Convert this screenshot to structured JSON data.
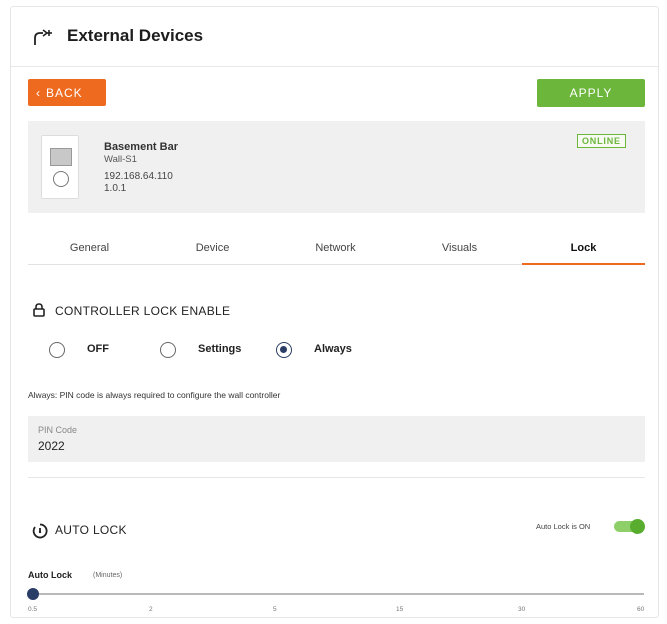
{
  "header": {
    "title": "External Devices",
    "icon": "external-device-icon"
  },
  "actions": {
    "back_label": "BACK",
    "back_icon": "chevron-left-icon",
    "apply_label": "APPLY"
  },
  "device": {
    "name": "Basement Bar",
    "model": "Wall-S1",
    "ip": "192.168.64.110",
    "version": "1.0.1",
    "status": "ONLINE"
  },
  "tabs": [
    {
      "label": "General"
    },
    {
      "label": "Device"
    },
    {
      "label": "Network"
    },
    {
      "label": "Visuals"
    },
    {
      "label": "Lock",
      "active": true
    }
  ],
  "lock": {
    "title": "CONTROLLER LOCK ENABLE",
    "options": [
      {
        "label": "OFF",
        "selected": false
      },
      {
        "label": "Settings",
        "selected": false
      },
      {
        "label": "Always",
        "selected": true
      }
    ],
    "description": "Always: PIN code is always required to configure the wall controller",
    "pin_label": "PIN Code",
    "pin_value": "2022"
  },
  "auto_lock": {
    "title": "AUTO LOCK",
    "toggle_label": "Auto Lock is ON",
    "toggle_on": true,
    "slider_label": "Auto Lock",
    "slider_unit": "(Minutes)",
    "slider_value": "0.5",
    "ticks": [
      "0.5",
      "2",
      "5",
      "15",
      "30",
      "60"
    ]
  },
  "colors": {
    "accent_orange": "#ee6a1f",
    "accent_green": "#6cb63b",
    "selected_navy": "#2a3d66"
  }
}
